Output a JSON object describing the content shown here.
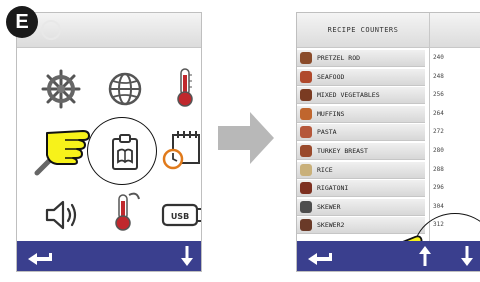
{
  "step_badge": "E",
  "left_screen": {
    "icons": [
      "ship-wheel-icon",
      "globe-icon",
      "thermometer-icon",
      "magnifier-icon",
      "recipe-book-icon",
      "calendar-clock-icon",
      "speaker-icon",
      "probe-thermometer-icon",
      "usb-icon"
    ]
  },
  "right_screen": {
    "title": "RECIPE COUNTERS",
    "recipes": [
      {
        "name": "PRETZEL ROD",
        "count": "240"
      },
      {
        "name": "SEAFOOD",
        "count": "248"
      },
      {
        "name": "MIXED VEGETABLES",
        "count": "256"
      },
      {
        "name": "MUFFINS",
        "count": "264"
      },
      {
        "name": "PASTA",
        "count": "272"
      },
      {
        "name": "TURKEY BREAST",
        "count": "280"
      },
      {
        "name": "RICE",
        "count": "288"
      },
      {
        "name": "RIGATONI",
        "count": "296"
      },
      {
        "name": "SKEWER",
        "count": "304"
      },
      {
        "name": "SKEWER2",
        "count": "312"
      }
    ]
  },
  "usb_label": "USB",
  "colors": {
    "bar": "#3a3f8e",
    "arrow": "#b8b8b8",
    "hand": "#f7f21a"
  }
}
